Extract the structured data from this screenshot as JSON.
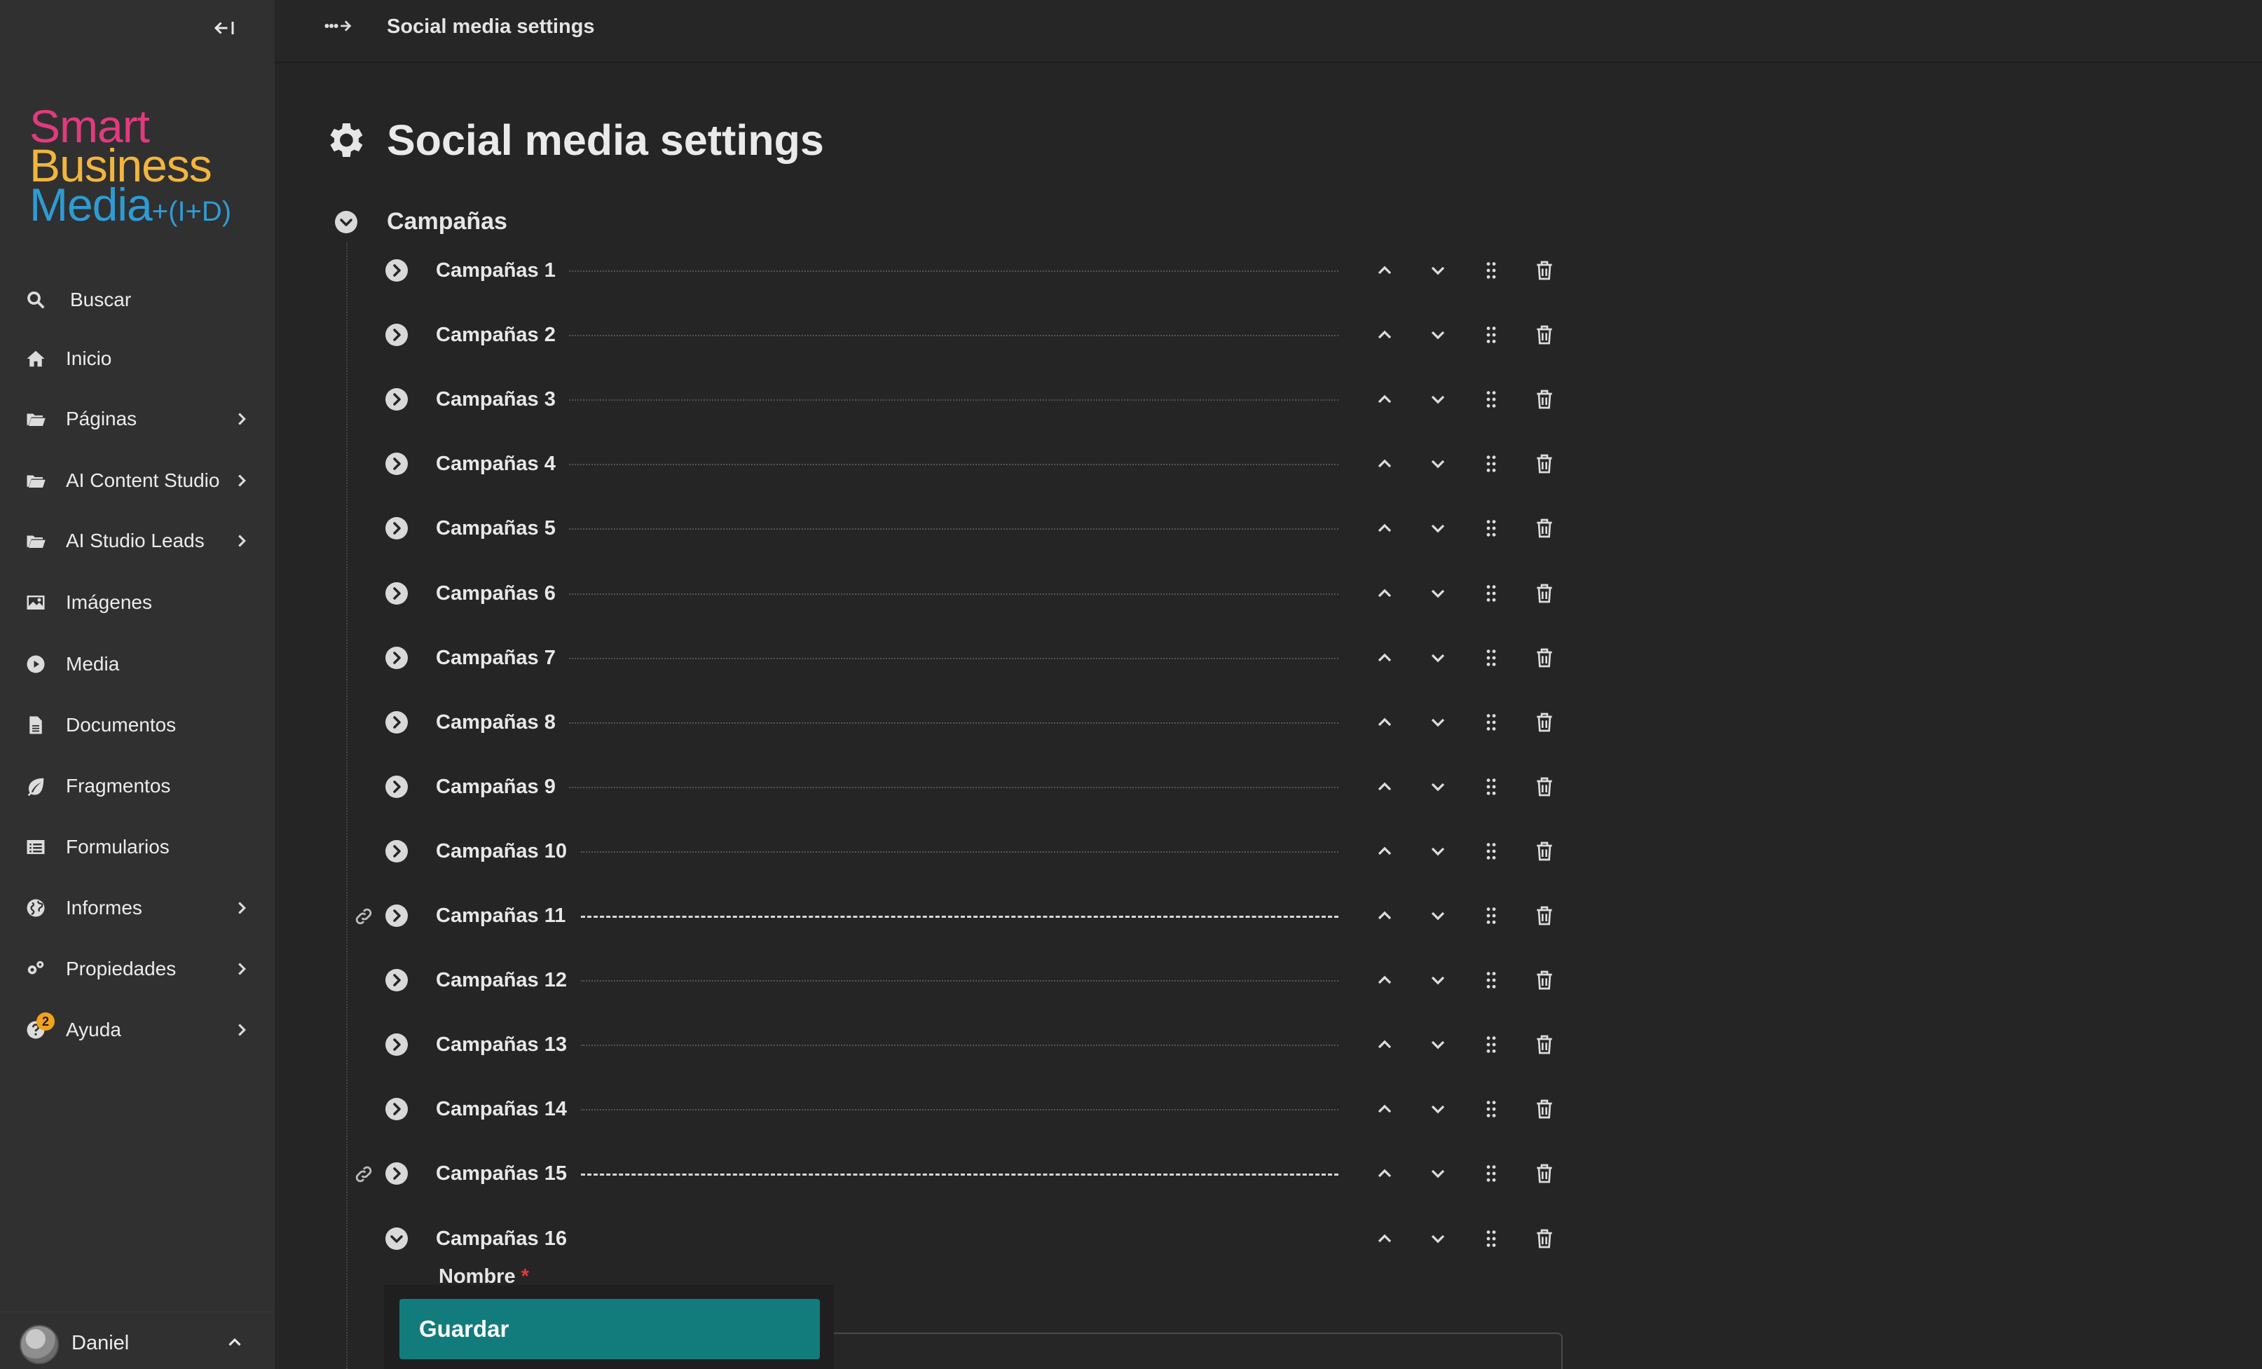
{
  "sidebar": {
    "collapse_icon": "collapse-left-icon",
    "logo": {
      "line1": "Smart",
      "line2": "Business",
      "line3": "Media",
      "suffix": "+(I+D)"
    },
    "items": [
      {
        "label": "Buscar",
        "icon": "search-icon",
        "has_submenu": false
      },
      {
        "label": "Inicio",
        "icon": "home-icon",
        "has_submenu": false
      },
      {
        "label": "Páginas",
        "icon": "folder-open-icon",
        "has_submenu": true
      },
      {
        "label": "AI Content Studio",
        "icon": "folder-open-icon",
        "has_submenu": true
      },
      {
        "label": "AI Studio Leads",
        "icon": "folder-open-icon",
        "has_submenu": true
      },
      {
        "label": "Imágenes",
        "icon": "image-icon",
        "has_submenu": false
      },
      {
        "label": "Media",
        "icon": "play-circle-icon",
        "has_submenu": false
      },
      {
        "label": "Documentos",
        "icon": "file-icon",
        "has_submenu": false
      },
      {
        "label": "Fragmentos",
        "icon": "leaf-icon",
        "has_submenu": false
      },
      {
        "label": "Formularios",
        "icon": "list-icon",
        "has_submenu": false
      },
      {
        "label": "Informes",
        "icon": "globe-icon",
        "has_submenu": true
      },
      {
        "label": "Propiedades",
        "icon": "gears-icon",
        "has_submenu": true
      },
      {
        "label": "Ayuda",
        "icon": "help-icon",
        "has_submenu": true,
        "badge": "2"
      }
    ],
    "user": {
      "name": "Daniel"
    }
  },
  "topbar": {
    "breadcrumb": "Social media settings",
    "breadcrumb_icon": "arrow-path-icon"
  },
  "main": {
    "title": "Social media settings",
    "title_icon": "gear-icon",
    "section": {
      "label": "Campañas",
      "expanded": true
    },
    "items": [
      {
        "label": "Campañas 1",
        "linked": false,
        "expanded": false
      },
      {
        "label": "Campañas 2",
        "linked": false,
        "expanded": false
      },
      {
        "label": "Campañas 3",
        "linked": false,
        "expanded": false
      },
      {
        "label": "Campañas 4",
        "linked": false,
        "expanded": false
      },
      {
        "label": "Campañas 5",
        "linked": false,
        "expanded": false
      },
      {
        "label": "Campañas 6",
        "linked": false,
        "expanded": false
      },
      {
        "label": "Campañas 7",
        "linked": false,
        "expanded": false
      },
      {
        "label": "Campañas 8",
        "linked": false,
        "expanded": false
      },
      {
        "label": "Campañas 9",
        "linked": false,
        "expanded": false
      },
      {
        "label": "Campañas 10",
        "linked": false,
        "expanded": false
      },
      {
        "label": "Campañas 11",
        "linked": true,
        "expanded": false,
        "highlighted": true
      },
      {
        "label": "Campañas 12",
        "linked": false,
        "expanded": false
      },
      {
        "label": "Campañas 13",
        "linked": false,
        "expanded": false
      },
      {
        "label": "Campañas 14",
        "linked": false,
        "expanded": false
      },
      {
        "label": "Campañas 15",
        "linked": true,
        "expanded": false,
        "highlighted": true
      },
      {
        "label": "Campañas 16",
        "linked": false,
        "expanded": true
      }
    ],
    "field": {
      "label": "Nombre",
      "required_mark": "*",
      "value": ""
    },
    "save_label": "Guardar"
  },
  "colors": {
    "save_button": "#127c7d",
    "logo_pink": "#e23a7f",
    "logo_yellow": "#f2b53c",
    "logo_blue": "#2f9bd3",
    "badge": "#f2a21b"
  }
}
